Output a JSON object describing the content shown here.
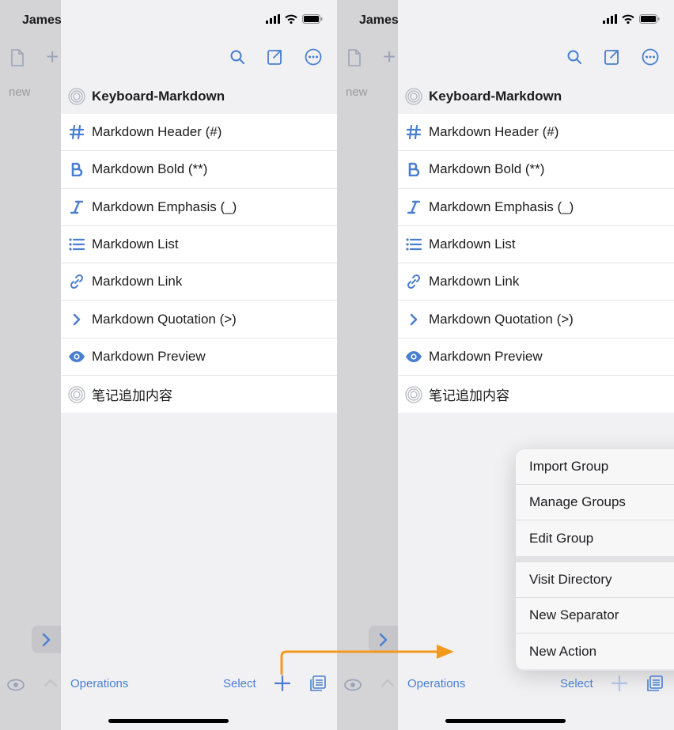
{
  "back_screen": {
    "user_name": "James",
    "new_label": "new"
  },
  "group": {
    "title": "Keyboard-Markdown"
  },
  "actions": [
    {
      "label": "Markdown Header (#)",
      "icon": "hash-icon"
    },
    {
      "label": "Markdown Bold (**)",
      "icon": "bold-icon"
    },
    {
      "label": "Markdown Emphasis (_)",
      "icon": "italic-icon"
    },
    {
      "label": "Markdown List",
      "icon": "list-icon"
    },
    {
      "label": "Markdown Link",
      "icon": "link-icon"
    },
    {
      "label": "Markdown Quotation (>)",
      "icon": "chevron-right-icon"
    },
    {
      "label": "Markdown Preview",
      "icon": "eye-icon"
    },
    {
      "label": "笔记追加内容",
      "icon": "target-icon"
    }
  ],
  "bottom_bar": {
    "operations_label": "Operations",
    "select_label": "Select"
  },
  "menu": {
    "group1": [
      {
        "label": "Import Group",
        "icon": "import-icon"
      },
      {
        "label": "Manage Groups",
        "icon": "list-circle-icon"
      },
      {
        "label": "Edit Group",
        "icon": "edit-circle-icon"
      }
    ],
    "group2": [
      {
        "label": "Visit Directory",
        "icon": "link-circle-icon"
      },
      {
        "label": "New Separator",
        "icon": "plus-square-icon"
      },
      {
        "label": "New Action",
        "icon": "plus-icon"
      }
    ]
  },
  "colors": {
    "accent": "#4a7fd0",
    "arrow": "#f39a1e",
    "panel": "#f1f1f3",
    "backdrop": "#d4d4d6"
  }
}
